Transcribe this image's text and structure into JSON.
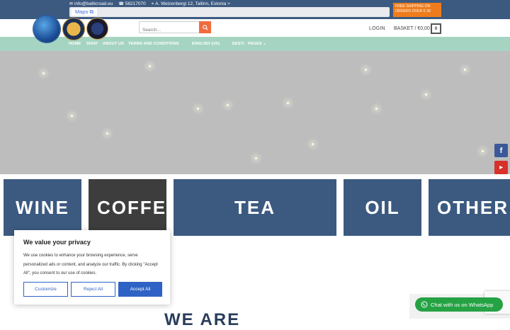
{
  "topbar": {
    "email": "info@balticroad.eu",
    "phone": "56217070",
    "address": "A. Weizenbergi 12, Tallinn, Estonia >",
    "maps_label": "Maps",
    "shipping_line1": "FREE SHIPPING ON",
    "shipping_line2": "ORDERS OVER € 30"
  },
  "header": {
    "search_placeholder": "Search...",
    "login_label": "LOGIN",
    "basket_label": "BASKET / €0,00",
    "basket_count": "0"
  },
  "nav": {
    "items": [
      "HOME",
      "SHOP",
      "ABOUT US",
      "TERMS AND CONDITIONS",
      "ENGLISH (UK)",
      "EESTI",
      "PAGES"
    ]
  },
  "categories": [
    "WINE",
    "COFFEE",
    "TEA",
    "OIL",
    "OTHER"
  ],
  "cookie": {
    "title": "We value your privacy",
    "text": "We use cookies to enhance your browsing experience, serve personalized ads or content, and analyze our traffic. By clicking \"Accept All\", you consent to our use of cookies.",
    "customize_label": "Customize",
    "reject_label": "Reject All",
    "accept_label": "Accept All"
  },
  "section_title": "WE ARE",
  "whatsapp_label": "Chat with us on WhatsApp",
  "colors": {
    "topbar": "#3c5a80",
    "nav": "#a6d4c2",
    "accent": "#ef7c1c",
    "cookie_button": "#2e63c5",
    "whatsapp": "#25a244"
  },
  "icons": [
    "envelope-icon",
    "phone-icon",
    "location-icon",
    "external-link-icon",
    "search-icon",
    "chevron-down-icon",
    "facebook-icon",
    "youtube-icon",
    "whatsapp-icon"
  ]
}
